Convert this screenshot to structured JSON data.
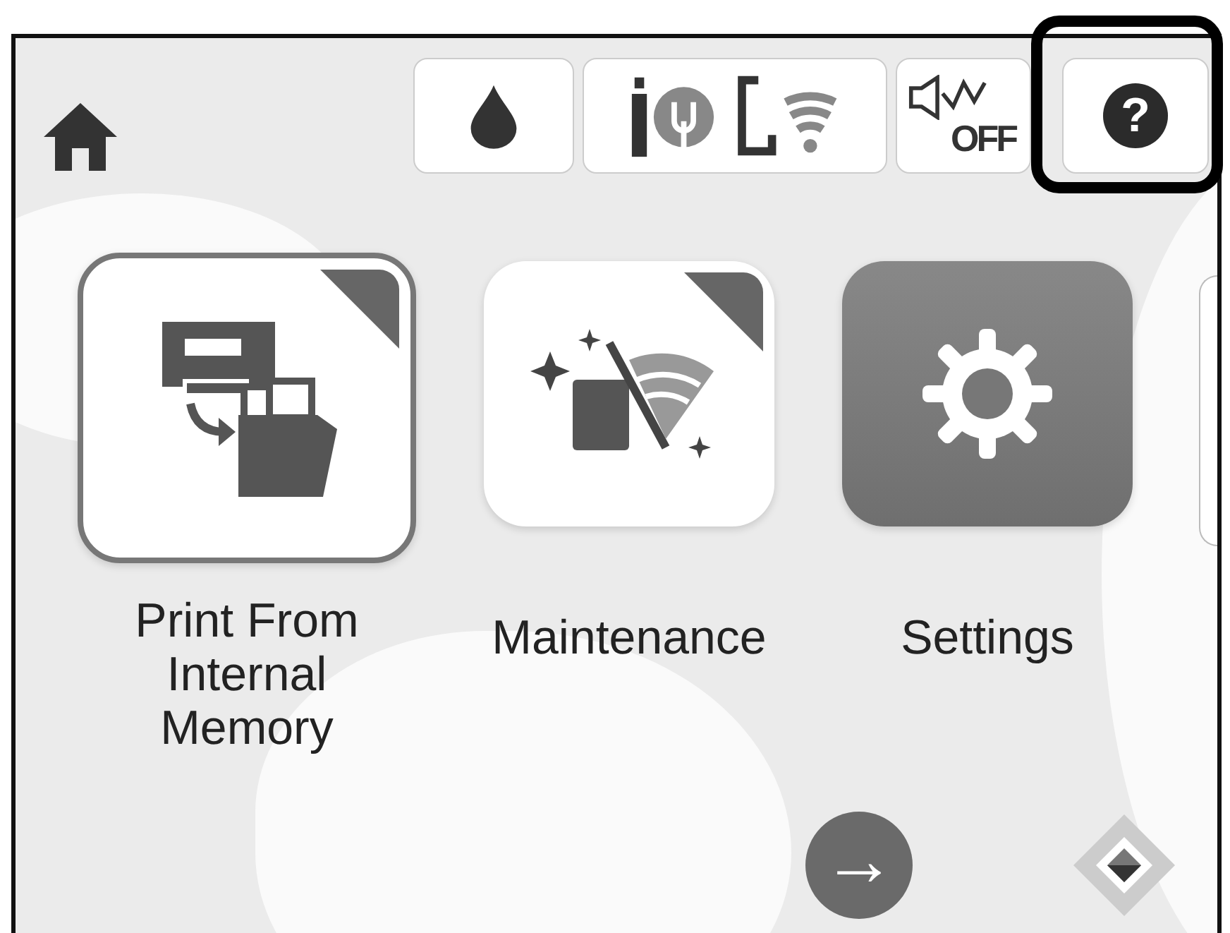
{
  "status_icons": [
    {
      "kind": "ink"
    },
    {
      "kind": "network"
    },
    {
      "kind": "sound",
      "label": "OFF"
    }
  ],
  "help": {
    "label": "?",
    "highlighted": true
  },
  "apps": [
    {
      "kind": "print",
      "label": "Print From Internal Memory",
      "selected": true,
      "corner": true
    },
    {
      "kind": "maintenance",
      "label": "Maintenance",
      "selected": false,
      "corner": true
    },
    {
      "kind": "settings",
      "label": "Settings",
      "selected": false,
      "corner": false
    }
  ],
  "nav": {
    "next_arrow": "→"
  }
}
